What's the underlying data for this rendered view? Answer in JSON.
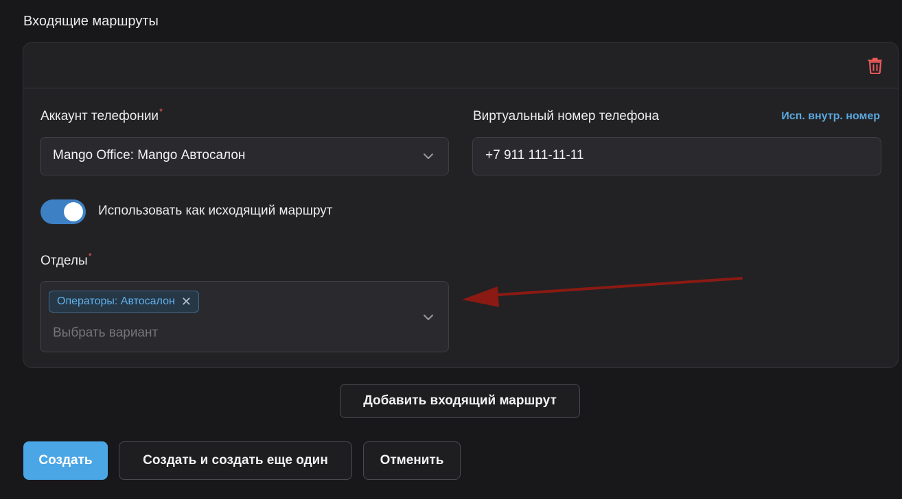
{
  "section": {
    "title": "Входящие маршруты"
  },
  "route": {
    "telephony_account": {
      "label": "Аккаунт телефонии",
      "required_mark": "*",
      "value": "Mango Office: Mango Автосалон"
    },
    "virtual_number": {
      "label": "Виртуальный номер телефона",
      "action_link": "Исп. внутр. номер",
      "value": "+7 911 111-11-11"
    },
    "outgoing_toggle": {
      "label": "Использовать как исходящий маршрут",
      "checked": true
    },
    "departments": {
      "label": "Отделы",
      "required_mark": "*",
      "selected_tags": [
        "Операторы: Автосалон"
      ],
      "placeholder": "Выбрать вариант"
    }
  },
  "actions": {
    "add_route": "Добавить входящий маршрут",
    "create": "Создать",
    "create_another": "Создать и создать еще один",
    "cancel": "Отменить"
  },
  "colors": {
    "accent": "#4ba6e6",
    "danger": "#ef5a5a",
    "annotation_arrow": "#8b1a12"
  },
  "icons": {
    "delete": "trash-icon",
    "dropdown": "chevron-down-icon",
    "tag_remove": "close-icon"
  }
}
